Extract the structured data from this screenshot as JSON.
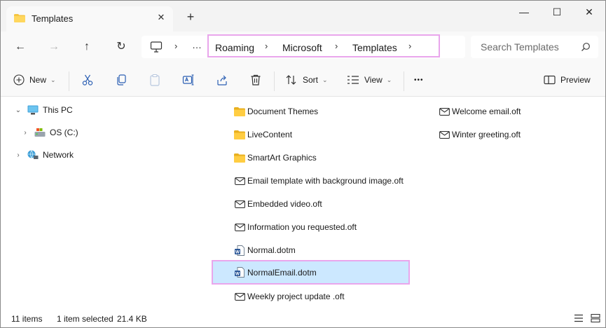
{
  "window": {
    "tab_title": "Templates",
    "controls": {
      "minimize": "—",
      "maximize": "☐",
      "close": "✕"
    }
  },
  "navigation": {
    "breadcrumb": [
      "Roaming",
      "Microsoft",
      "Templates"
    ],
    "more": "…",
    "search_placeholder": "Search Templates"
  },
  "commands": {
    "new": "New",
    "sort": "Sort",
    "view": "View",
    "more": "•••",
    "preview": "Preview"
  },
  "tree": [
    {
      "label": "This PC",
      "expanded": true,
      "icon": "monitor-icon"
    },
    {
      "label": "OS (C:)",
      "expanded": false,
      "icon": "drive-icon"
    },
    {
      "label": "Network",
      "expanded": false,
      "icon": "network-icon"
    }
  ],
  "files": [
    {
      "name": "Document Themes",
      "type": "folder"
    },
    {
      "name": "LiveContent",
      "type": "folder"
    },
    {
      "name": "SmartArt Graphics",
      "type": "folder"
    },
    {
      "name": "Email template with background image.oft",
      "type": "email"
    },
    {
      "name": "Embedded video.oft",
      "type": "email"
    },
    {
      "name": "Information you requested.oft",
      "type": "email"
    },
    {
      "name": "Normal.dotm",
      "type": "word"
    },
    {
      "name": "NormalEmail.dotm",
      "type": "word",
      "selected": true
    },
    {
      "name": "Weekly project update .oft",
      "type": "email"
    },
    {
      "name": "Welcome email.oft",
      "type": "email"
    },
    {
      "name": "Winter greeting.oft",
      "type": "email"
    }
  ],
  "status": {
    "item_count": "11 items",
    "selection": "1 item selected",
    "size": "21.4 KB"
  },
  "colors": {
    "folder": "#f5c542",
    "selection": "#cce8ff",
    "highlight": "#e9a6ec",
    "word": "#2b5797"
  }
}
